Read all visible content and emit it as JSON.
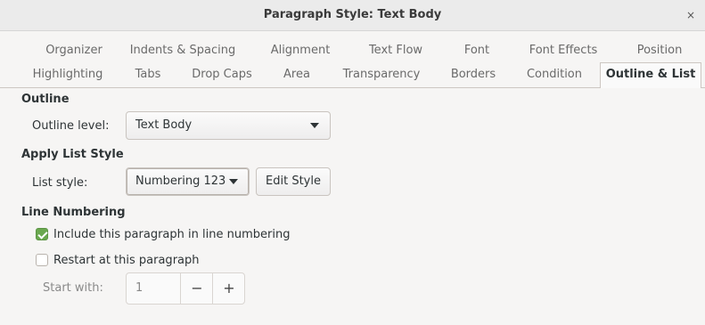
{
  "window": {
    "title": "Paragraph Style: Text Body",
    "close_glyph": "×"
  },
  "tabs_row1": [
    {
      "label": "Organizer",
      "active": false
    },
    {
      "label": "Indents & Spacing",
      "active": false
    },
    {
      "label": "Alignment",
      "active": false
    },
    {
      "label": "Text Flow",
      "active": false
    },
    {
      "label": "Font",
      "active": false
    },
    {
      "label": "Font Effects",
      "active": false
    },
    {
      "label": "Position",
      "active": false
    }
  ],
  "tabs_row2": [
    {
      "label": "Highlighting",
      "active": false
    },
    {
      "label": "Tabs",
      "active": false
    },
    {
      "label": "Drop Caps",
      "active": false
    },
    {
      "label": "Area",
      "active": false
    },
    {
      "label": "Transparency",
      "active": false
    },
    {
      "label": "Borders",
      "active": false
    },
    {
      "label": "Condition",
      "active": false
    },
    {
      "label": "Outline & List",
      "active": true
    }
  ],
  "outline": {
    "heading": "Outline",
    "level_label": "Outline level:",
    "level_value": "Text Body"
  },
  "list_style": {
    "heading": "Apply List Style",
    "label": "List style:",
    "value": "Numbering 123",
    "edit_button": "Edit Style"
  },
  "line_numbering": {
    "heading": "Line Numbering",
    "include_label": "Include this paragraph in line numbering",
    "include_checked": true,
    "restart_label": "Restart at this paragraph",
    "restart_checked": false,
    "start_label": "Start with:",
    "start_value": "1",
    "minus_glyph": "−",
    "plus_glyph": "+"
  },
  "colors": {
    "check_accent": "#6aa84f"
  }
}
